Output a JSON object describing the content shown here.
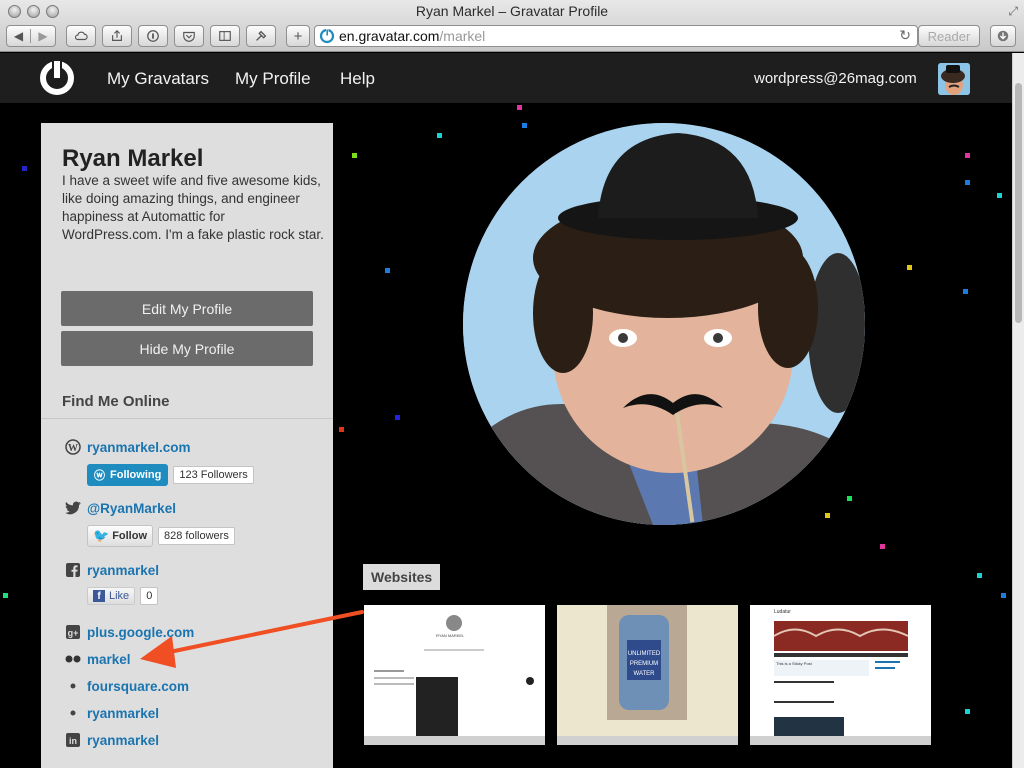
{
  "browser": {
    "window_title": "Ryan Markel – Gravatar Profile",
    "url_domain": "en.gravatar.com",
    "url_path": "/markel",
    "reader_label": "Reader",
    "add_label": "+"
  },
  "nav": {
    "items": [
      "My Gravatars",
      "My Profile",
      "Help"
    ],
    "email": "wordpress@26mag.com"
  },
  "profile": {
    "name": "Ryan Markel",
    "bio": "I have a sweet wife and five awesome kids, like doing amazing things, and engineer happiness at Automattic for WordPress.com. I'm a fake plastic rock star.",
    "edit_button": "Edit My Profile",
    "hide_button": "Hide My Profile",
    "find_me_title": "Find Me Online"
  },
  "accounts": [
    {
      "icon": "wordpress-icon",
      "label": "ryanmarkel.com"
    },
    {
      "icon": "twitter-icon",
      "label": "@RyanMarkel"
    },
    {
      "icon": "facebook-icon",
      "label": "ryanmarkel"
    },
    {
      "icon": "google-plus-icon",
      "label": "plus.google.com"
    },
    {
      "icon": "flickr-icon",
      "label": "markel"
    },
    {
      "icon": "dot-icon",
      "label": "foursquare.com"
    },
    {
      "icon": "dot-icon",
      "label": "ryanmarkel"
    },
    {
      "icon": "linkedin-icon",
      "label": "ryanmarkel"
    }
  ],
  "widgets": {
    "wp_following": "Following",
    "wp_followers": "123 Followers",
    "tw_follow": "Follow",
    "tw_followers": "828 followers",
    "fb_like": "Like",
    "fb_count": "0"
  },
  "websites": {
    "label": "Websites",
    "thumb_texts": [
      "RYAN MARKEL",
      "Ludatur",
      "This is a Sticky Post"
    ]
  },
  "colors": {
    "link": "#1a74b0",
    "nav_bg": "#1e1e1e",
    "annotation_arrow": "#f04e23"
  }
}
